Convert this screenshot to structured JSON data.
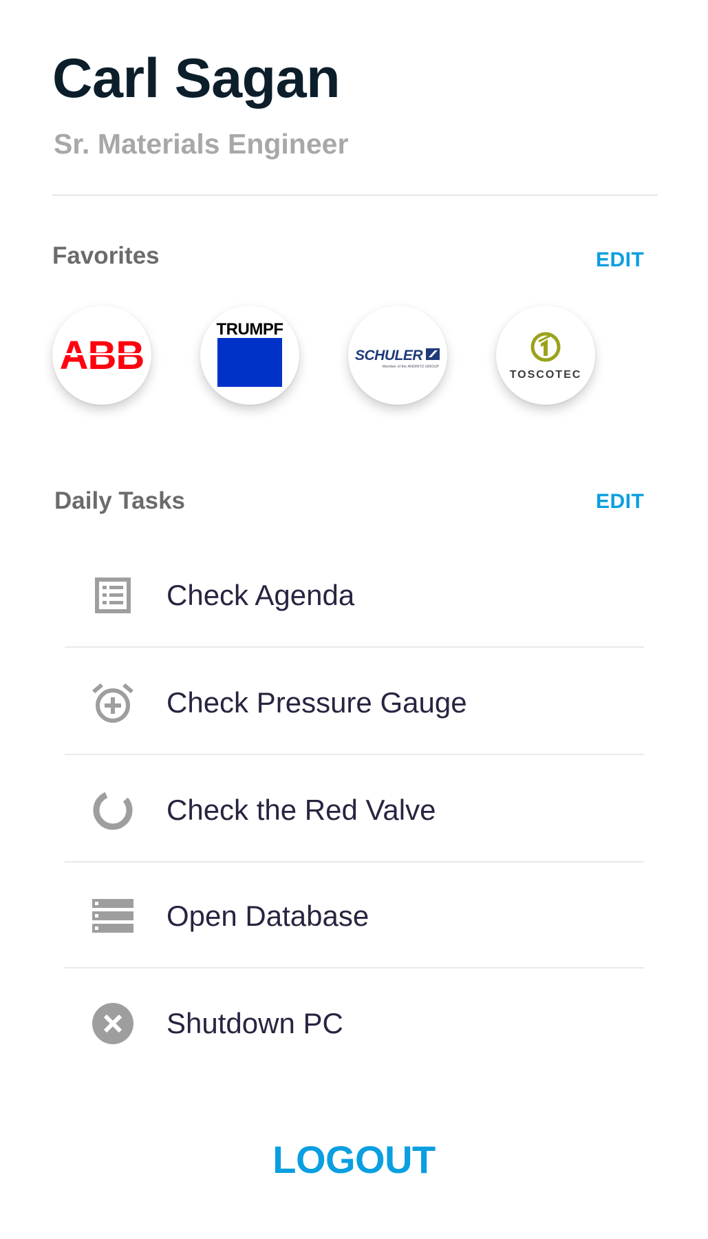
{
  "profile": {
    "name": "Carl Sagan",
    "title": "Sr. Materials Engineer"
  },
  "favorites": {
    "heading": "Favorites",
    "edit_label": "EDIT",
    "items": [
      {
        "name": "ABB",
        "logo_text": "ABB",
        "color": "#ff000f"
      },
      {
        "name": "TRUMPF",
        "logo_text": "TRUMPF",
        "color": "#0032c8"
      },
      {
        "name": "SCHULER",
        "logo_text": "SCHULER",
        "subtext": "Member of the ANDRITZ GROUP",
        "color": "#1f3a7a"
      },
      {
        "name": "TOSCOTEC",
        "logo_text": "TOSCOTEC",
        "color": "#9aa31a"
      }
    ]
  },
  "daily_tasks": {
    "heading": "Daily Tasks",
    "edit_label": "EDIT",
    "items": [
      {
        "label": "Check Agenda",
        "icon": "list-icon"
      },
      {
        "label": "Check Pressure Gauge",
        "icon": "alarm-add-icon"
      },
      {
        "label": "Check the Red Valve",
        "icon": "donut-icon"
      },
      {
        "label": "Open Database",
        "icon": "storage-icon"
      },
      {
        "label": "Shutdown PC",
        "icon": "cancel-icon"
      }
    ]
  },
  "logout_label": "LOGOUT",
  "colors": {
    "accent": "#0a9fe0",
    "name": "#0c1e2a",
    "icon": "#9e9e9e"
  }
}
